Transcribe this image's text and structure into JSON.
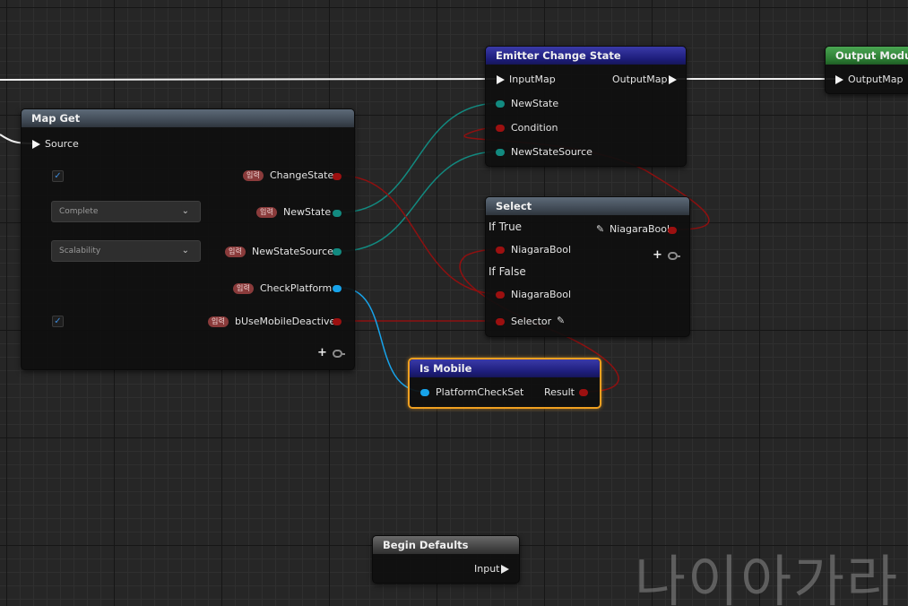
{
  "nodes": {
    "emitter_change_state": {
      "title": "Emitter Change State",
      "input_map": "InputMap",
      "output_map": "OutputMap",
      "new_state": "NewState",
      "condition": "Condition",
      "new_state_source": "NewStateSource"
    },
    "output_module": {
      "title": "Output Module",
      "output_map": "OutputMap"
    },
    "map_get": {
      "title": "Map Get",
      "source": "Source",
      "tag": "입력",
      "rows": [
        {
          "label": "ChangeState",
          "control": "checkbox",
          "checked": true,
          "pin_color": "red"
        },
        {
          "label": "NewState",
          "control": "dropdown",
          "value": "Complete",
          "pin_color": "teal"
        },
        {
          "label": "NewStateSource",
          "control": "dropdown",
          "value": "Scalability",
          "pin_color": "teal"
        },
        {
          "label": "CheckPlatform",
          "control": "none",
          "pin_color": "cyan"
        },
        {
          "label": "bUseMobileDeactive",
          "control": "checkbox",
          "checked": true,
          "pin_color": "red"
        }
      ]
    },
    "select": {
      "title": "Select",
      "if_true": "If True",
      "if_false": "If False",
      "output": "NiagaraBool",
      "true_in": "NiagaraBool",
      "false_in": "NiagaraBool",
      "selector": "Selector"
    },
    "is_mobile": {
      "title": "Is Mobile",
      "input": "PlatformCheckSet",
      "output": "Result"
    },
    "begin_defaults": {
      "title": "Begin Defaults",
      "input": "Input"
    }
  },
  "watermark": "나이아가라",
  "colors": {
    "bool_pin": "#9c1010",
    "enum_pin": "#128a80",
    "struct_pin": "#17a3ea",
    "node_header_blue": "#1d1d7a",
    "node_header_green": "#2c7c33",
    "selection": "#f0a020"
  }
}
